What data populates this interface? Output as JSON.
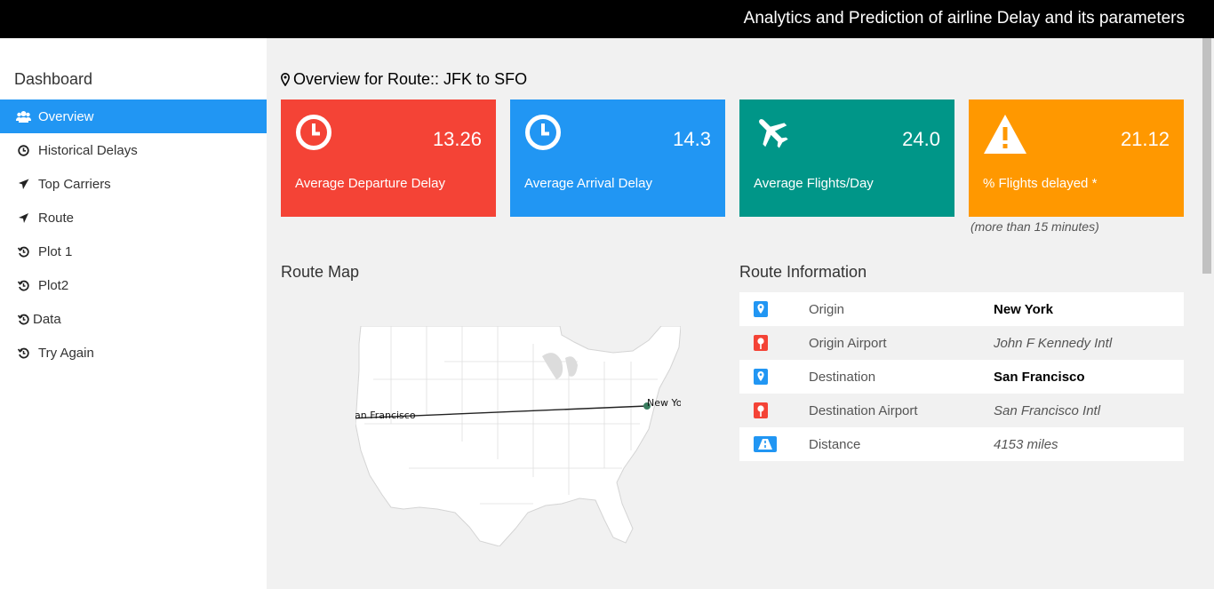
{
  "header": {
    "title": "Analytics and Prediction of airline Delay and its parameters"
  },
  "sidebar": {
    "title": "Dashboard",
    "items": [
      {
        "label": "Overview",
        "icon": "users-icon",
        "active": true
      },
      {
        "label": "Historical Delays",
        "icon": "clock-icon"
      },
      {
        "label": "Top Carriers",
        "icon": "plane-icon"
      },
      {
        "label": "Route",
        "icon": "location-arrow-icon"
      },
      {
        "label": "Plot 1",
        "icon": "history-icon"
      },
      {
        "label": "Plot2",
        "icon": "history-icon"
      },
      {
        "label": "Data",
        "icon": "history-icon"
      },
      {
        "label": "Try Again",
        "icon": "history-icon"
      }
    ]
  },
  "main": {
    "heading": "Overview for Route:: JFK to SFO",
    "cards": [
      {
        "value": "13.26",
        "label": "Average Departure Delay",
        "color": "#f44336",
        "icon": "clock-icon"
      },
      {
        "value": "14.3",
        "label": "Average Arrival Delay",
        "color": "#2196f3",
        "icon": "clock-icon"
      },
      {
        "value": "24.0",
        "label": "Average Flights/Day",
        "color": "#009688",
        "icon": "plane-icon"
      },
      {
        "value": "21.12",
        "label": "% Flights delayed *",
        "color": "#ff9800",
        "icon": "warning-icon"
      }
    ],
    "note": "(more than 15 minutes)",
    "map": {
      "title": "Route Map",
      "origin_label": "New York",
      "destination_label": "San Francisco"
    },
    "route_info": {
      "title": "Route Information",
      "rows": [
        {
          "key": "Origin",
          "value": "New York",
          "icon": "map-marker-icon"
        },
        {
          "key": "Origin Airport",
          "value": "John F Kennedy Intl",
          "icon": "map-pin-icon"
        },
        {
          "key": "Destination",
          "value": "San Francisco",
          "icon": "map-marker-icon"
        },
        {
          "key": "Destination Airport",
          "value": "San Francisco Intl",
          "icon": "map-pin-icon"
        },
        {
          "key": "Distance",
          "value": "4153 miles",
          "icon": "road-icon"
        }
      ]
    }
  }
}
